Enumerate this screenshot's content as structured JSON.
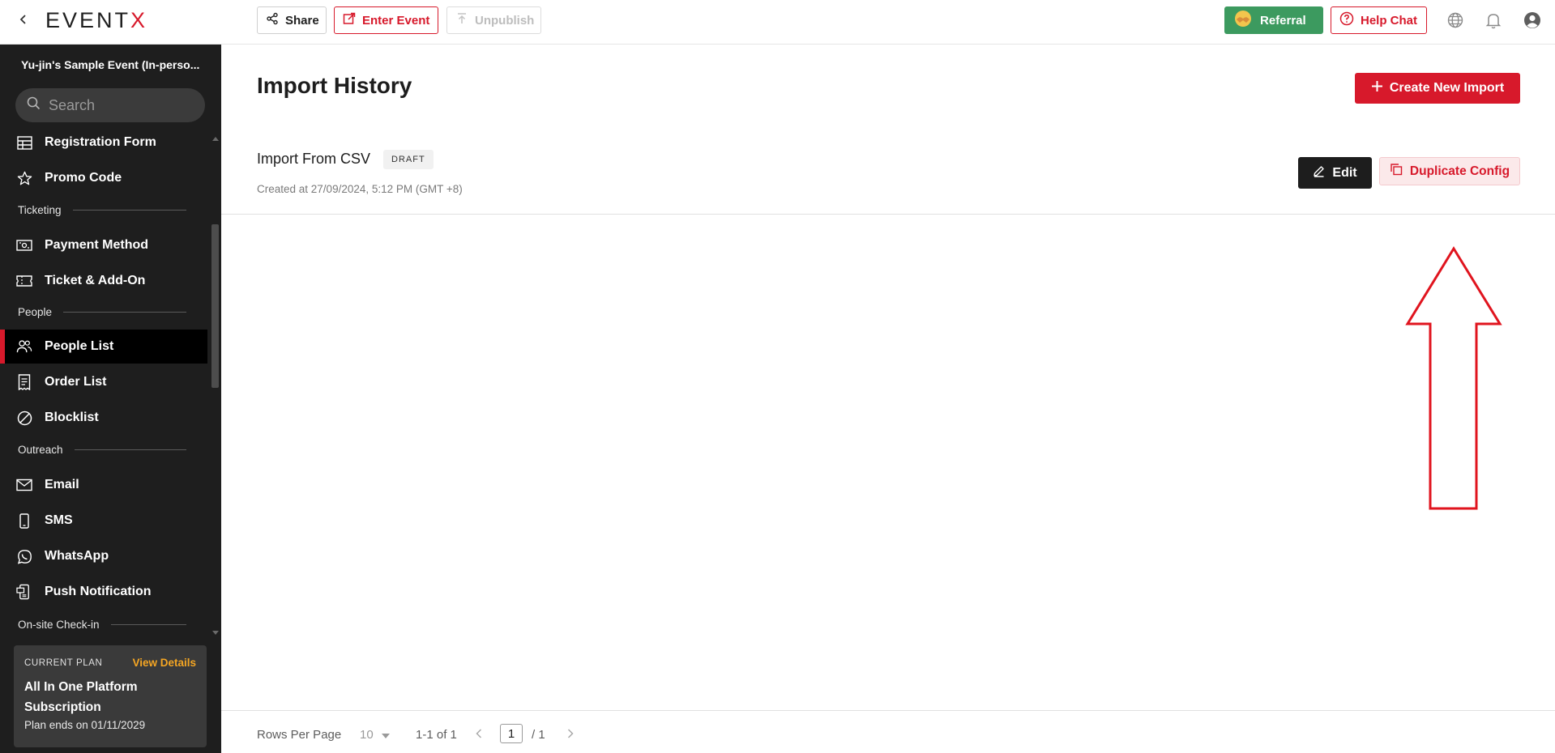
{
  "app": {
    "logo_text": "EVENT",
    "logo_accent": "X"
  },
  "topbar": {
    "share_label": "Share",
    "enter_event_label": "Enter Event",
    "unpublish_label": "Unpublish",
    "referral_label": "Referral",
    "help_chat_label": "Help Chat"
  },
  "sidebar": {
    "event_name": "Yu-jin's Sample Event (In-perso...",
    "search_placeholder": "Search",
    "items": [
      {
        "label": "Registration Form",
        "icon": "table-icon"
      },
      {
        "label": "Promo Code",
        "icon": "star-icon"
      },
      {
        "label": "Payment Method",
        "icon": "money-icon"
      },
      {
        "label": "Ticket & Add-On",
        "icon": "ticket-icon"
      },
      {
        "label": "People List",
        "icon": "people-icon",
        "active": true
      },
      {
        "label": "Order List",
        "icon": "receipt-icon"
      },
      {
        "label": "Blocklist",
        "icon": "block-icon"
      },
      {
        "label": "Email",
        "icon": "mail-icon"
      },
      {
        "label": "SMS",
        "icon": "phone-icon"
      },
      {
        "label": "WhatsApp",
        "icon": "whatsapp-icon"
      },
      {
        "label": "Push Notification",
        "icon": "push-notification-icon"
      }
    ],
    "sections": {
      "ticketing": "Ticketing",
      "people": "People",
      "outreach": "Outreach",
      "onsite": "On-site Check-in"
    },
    "plan": {
      "label": "CURRENT PLAN",
      "view_details": "View Details",
      "name": "All In One Platform Subscription",
      "ends": "Plan ends on 01/11/2029"
    }
  },
  "main": {
    "title": "Import History",
    "create_button": "Create New Import",
    "imports": [
      {
        "name": "Import From CSV",
        "status": "DRAFT",
        "created": "Created at 27/09/2024, 5:12 PM (GMT +8)",
        "edit_label": "Edit",
        "duplicate_label": "Duplicate Config"
      }
    ]
  },
  "pagination": {
    "rows_per_page_label": "Rows Per Page",
    "rows_per_page_value": "10",
    "range": "1-1 of 1",
    "current_page": "1",
    "total_pages": "/ 1"
  },
  "colors": {
    "brand_red": "#d7192b",
    "sidebar_bg": "#1e1e1e",
    "referral_green": "#3c9a5f",
    "plan_link": "#f5a623",
    "annotation_arrow": "#e0141e"
  }
}
